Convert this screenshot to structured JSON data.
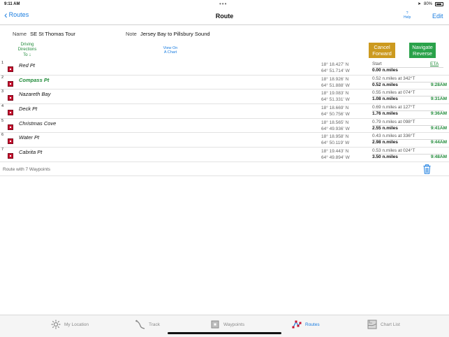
{
  "status": {
    "time": "9:11 AM",
    "battery": "80%"
  },
  "nav": {
    "back_label": "Routes",
    "title": "Route",
    "help_mark": "?",
    "help_label": "Help",
    "edit_label": "Edit"
  },
  "route": {
    "name_label": "Name",
    "name": "SE St Thomas Tour",
    "note_label": "Note",
    "note": "Jersey Bay to Pillsbury Sound"
  },
  "actions": {
    "driving_l1": "Driving",
    "driving_l2": "Directions",
    "driving_l3": "To",
    "view_l1": "View On",
    "view_l2": "A Chart",
    "cancel_l1": "Cancel",
    "cancel_l2": "Forward",
    "navigate_l1": "Navigate",
    "navigate_l2": "Reverse"
  },
  "eta_header": "ETA",
  "waypoints": [
    {
      "num": "1",
      "name": "Red Pt",
      "lat": "18° 18.427' N",
      "lon": "64° 51.714' W",
      "leg": "Start",
      "total": "0.00 n.miles",
      "eta": ""
    },
    {
      "num": "2",
      "name": "Compass Pt",
      "lat": "18° 18.926' N",
      "lon": "64° 51.888' W",
      "leg": "0.52 n.miles  at 342°T",
      "total": "0.52 n.miles",
      "eta": "9:28AM"
    },
    {
      "num": "3",
      "name": "Nazareth Bay",
      "lat": "18° 19.083' N",
      "lon": "64° 51.331' W",
      "leg": "0.55 n.miles  at 074°T",
      "total": "1.08 n.miles",
      "eta": "9:31AM"
    },
    {
      "num": "4",
      "name": "Deck Pt",
      "lat": "18° 18.669' N",
      "lon": "64° 50.756' W",
      "leg": "0.69 n.miles  at 127°T",
      "total": "1.76 n.miles",
      "eta": "9:36AM"
    },
    {
      "num": "5",
      "name": "Christmas Cove",
      "lat": "18° 18.565' N",
      "lon": "64° 49.936' W",
      "leg": "0.79 n.miles  at 098°T",
      "total": "2.55 n.miles",
      "eta": "9:41AM"
    },
    {
      "num": "6",
      "name": "Water Pt",
      "lat": "18° 18.958' N",
      "lon": "64° 50.119' W",
      "leg": "0.43 n.miles  at 336°T",
      "total": "2.98 n.miles",
      "eta": "9:44AM"
    },
    {
      "num": "7",
      "name": "Cabrita Pt",
      "lat": "18° 19.443' N",
      "lon": "64° 49.894' W",
      "leg": "0.53 n.miles  at 024°T",
      "total": "3.50 n.miles",
      "eta": "9:48AM"
    }
  ],
  "summary": "Route with 7 Waypoints",
  "tabs": [
    {
      "label": "My Location"
    },
    {
      "label": "Track"
    },
    {
      "label": "Waypoints"
    },
    {
      "label": "Routes"
    },
    {
      "label": "Chart List"
    }
  ],
  "colors": {
    "accent": "#1a7de0",
    "green": "#1f8a38",
    "cancel": "#cc9a1f",
    "navigate": "#2aa24a",
    "marker": "#c8102e"
  }
}
